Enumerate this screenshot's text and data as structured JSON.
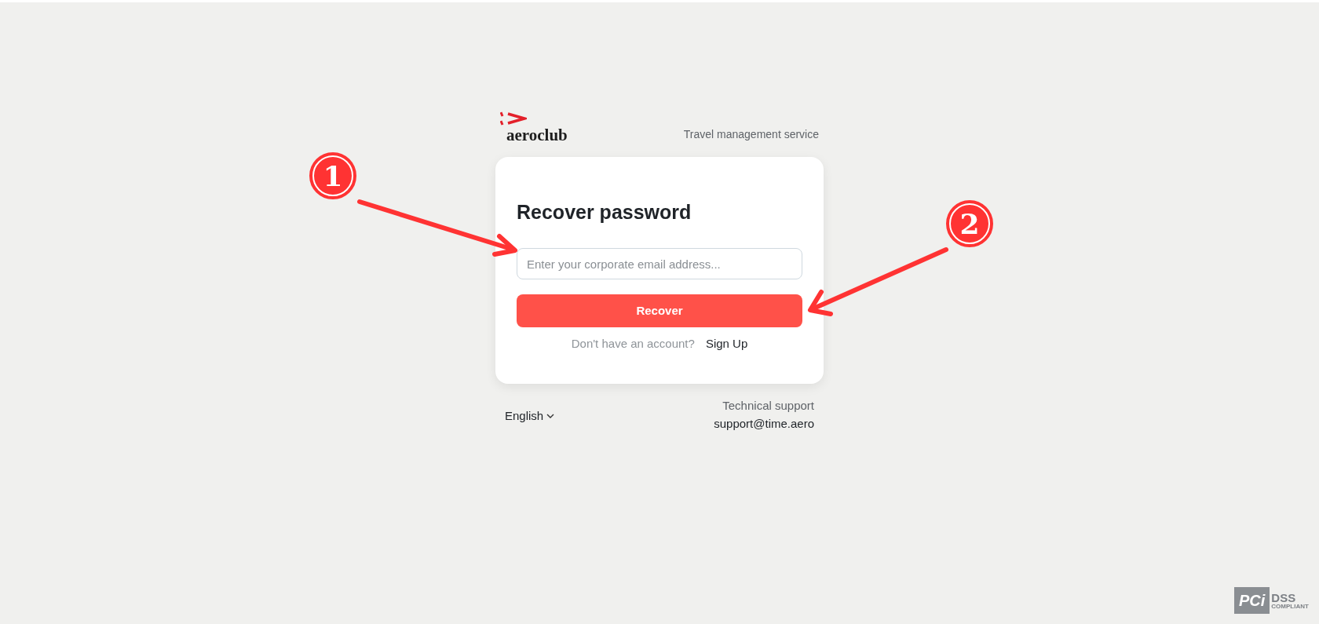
{
  "header": {
    "logo": "aeroclub",
    "tagline": "Travel management service"
  },
  "card": {
    "title": "Recover password",
    "email_field": {
      "placeholder": "Enter your corporate email address..."
    },
    "button": "Recover",
    "signup_prompt": "Don't have an account?",
    "signup_link": "Sign Up"
  },
  "footer": {
    "language": "English",
    "support_label": "Technical support",
    "support_email": "support@time.aero"
  },
  "annotations": [
    {
      "number": "1"
    },
    {
      "number": "2"
    }
  ],
  "compliance_badge": {
    "mark": "PCi",
    "title": "DSS",
    "subtitle": "COMPLIANT"
  }
}
